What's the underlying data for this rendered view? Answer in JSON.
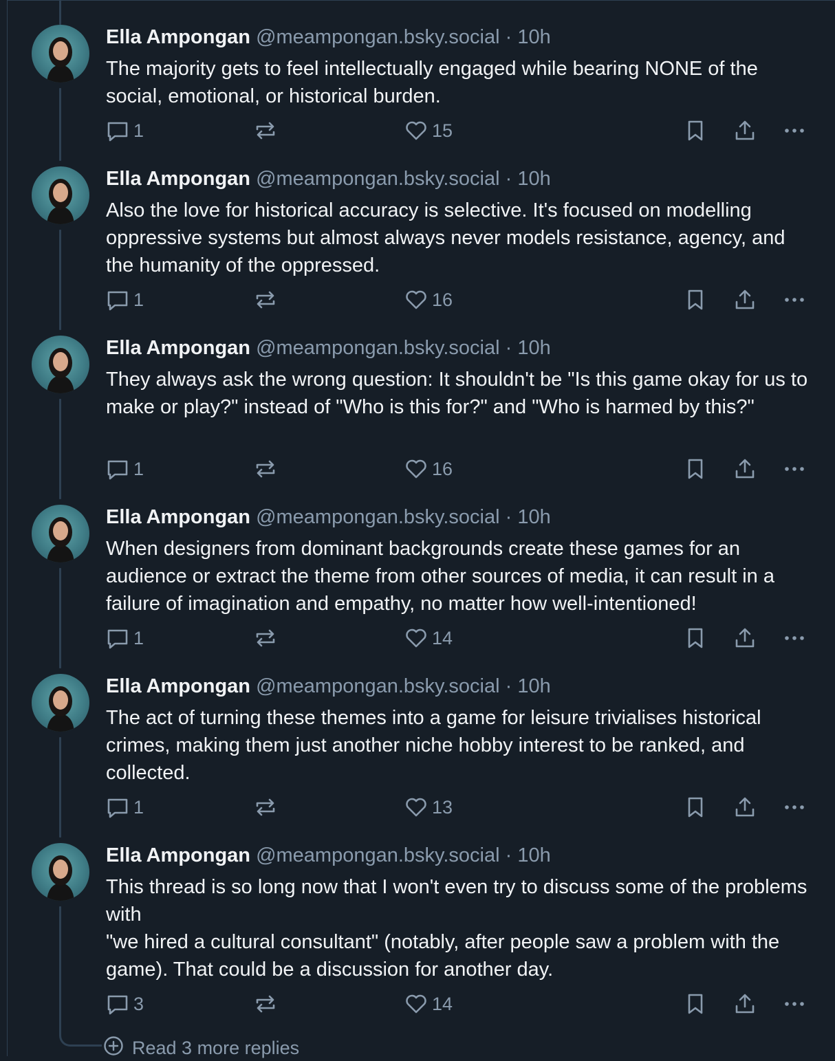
{
  "posts": [
    {
      "name": "Ella Ampongan",
      "handle": "@meampongan.bsky.social",
      "time": "· 10h",
      "text": "The majority gets to feel intellectually engaged while bearing NONE of the social, emotional, or historical burden.",
      "replies": "1",
      "likes": "15"
    },
    {
      "name": "Ella Ampongan",
      "handle": "@meampongan.bsky.social",
      "time": "· 10h",
      "text": "Also the love for historical accuracy is selective. It's focused on modelling oppressive systems but almost always never models resistance, agency, and the humanity of the oppressed.",
      "replies": "1",
      "likes": "16"
    },
    {
      "name": "Ella Ampongan",
      "handle": "@meampongan.bsky.social",
      "time": "· 10h",
      "text": "They always ask the wrong question: It shouldn't be \"Is this game okay for us to make or play?\" instead of \"Who is this for?\" and \"Who is harmed by this?\"",
      "replies": "1",
      "likes": "16"
    },
    {
      "name": "Ella Ampongan",
      "handle": "@meampongan.bsky.social",
      "time": "· 10h",
      "text": "When designers from dominant backgrounds create these games for an audience or extract the theme from other sources of media, it can result in a failure of imagination and empathy, no matter how well-intentioned!",
      "replies": "1",
      "likes": "14"
    },
    {
      "name": "Ella Ampongan",
      "handle": "@meampongan.bsky.social",
      "time": "· 10h",
      "text": "The act of turning these themes into a game for leisure  trivialises historical crimes, making them just another niche hobby interest to be ranked, and collected.",
      "replies": "1",
      "likes": "13"
    },
    {
      "name": "Ella Ampongan",
      "handle": "@meampongan.bsky.social",
      "time": "· 10h",
      "text": "This thread is so long now that I won't even try to discuss some of the problems with\n\"we hired a cultural consultant\" (notably, after people saw a problem with the game). That could be a discussion for another day.",
      "replies": "3",
      "likes": "14"
    }
  ],
  "read_more": "Read 3 more replies",
  "icons": {
    "reply": "speech-bubble-icon",
    "repost": "repost-arrows-icon",
    "like": "heart-icon",
    "bookmark": "bookmark-icon",
    "share": "share-upload-icon",
    "more": "ellipsis-icon",
    "read_more": "plus-circle-icon"
  },
  "colors": {
    "background": "#161e27",
    "text": "#f1f3f5",
    "muted": "#8a9bad",
    "thread_line": "#2e4052"
  }
}
